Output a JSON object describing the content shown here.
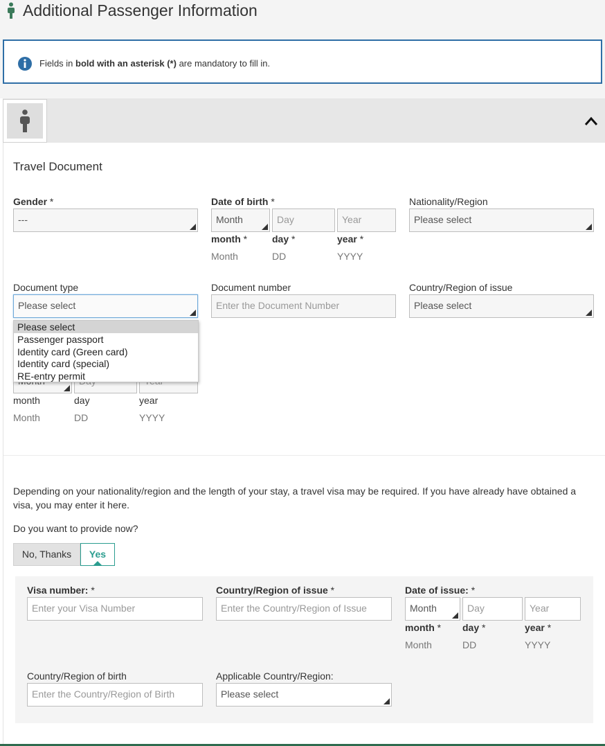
{
  "header": {
    "title": "Additional Passenger Information"
  },
  "info": {
    "prefix": "Fields in ",
    "bold": "bold with an asterisk (*)",
    "suffix": " are mandatory to fill in."
  },
  "travel_document": {
    "title": "Travel Document",
    "gender": {
      "label": "Gender",
      "asterisk": " *",
      "value": "---"
    },
    "dob": {
      "label": "Date of birth",
      "asterisk": " *",
      "month_value": "Month",
      "day_placeholder": "Day",
      "year_placeholder": "Year",
      "month_label": "month",
      "day_label": "day",
      "year_label": "year",
      "sub_asterisk": " *",
      "month_hint": "Month",
      "day_hint": "DD",
      "year_hint": "YYYY"
    },
    "nationality": {
      "label": "Nationality/Region",
      "value": "Please select"
    },
    "document_type": {
      "label": "Document type",
      "value": "Please select",
      "options": [
        "Please select",
        "Passenger passport",
        "Identity card (Green card)",
        "Identity card (special)",
        "RE-entry permit"
      ]
    },
    "document_number": {
      "label": "Document number",
      "placeholder": "Enter the Document Number"
    },
    "country_issue": {
      "label": "Country/Region of issue",
      "value": "Please select"
    },
    "expiry": {
      "month_value": "Month",
      "day_placeholder": "Day",
      "year_placeholder": "Year",
      "month_label": "month",
      "day_label": "day",
      "year_label": "year",
      "month_hint": "Month",
      "day_hint": "DD",
      "year_hint": "YYYY"
    }
  },
  "visa": {
    "paragraph": "Depending on your nationality/region and the length of your stay, a travel visa may be required. If you have already have obtained a visa, you may enter it here.",
    "question": "Do you want to provide now?",
    "no_label": "No, Thanks",
    "yes_label": "Yes",
    "number": {
      "label": "Visa number:",
      "asterisk": " *",
      "placeholder": "Enter your Visa Number"
    },
    "country_issue": {
      "label": "Country/Region of issue",
      "asterisk": " *",
      "placeholder": "Enter the Country/Region of Issue"
    },
    "date_issue": {
      "label": "Date of issue:",
      "asterisk": " *",
      "month_value": "Month",
      "day_placeholder": "Day",
      "year_placeholder": "Year",
      "month_label": "month",
      "day_label": "day",
      "year_label": "year",
      "sub_asterisk": " *",
      "month_hint": "Month",
      "day_hint": "DD",
      "year_hint": "YYYY"
    },
    "country_birth": {
      "label": "Country/Region of birth",
      "placeholder": "Enter the Country/Region of Birth"
    },
    "applicable": {
      "label": "Applicable Country/Region:",
      "value": "Please select"
    }
  },
  "colors": {
    "info_border": "#2e6ea6",
    "accent": "#2a9d8f",
    "icon_green": "#3b7a5a"
  },
  "icons": {
    "title_icon": "person-icon",
    "info_icon": "info-icon",
    "avatar_icon": "person-icon",
    "collapse_icon": "chevron-up-icon"
  }
}
